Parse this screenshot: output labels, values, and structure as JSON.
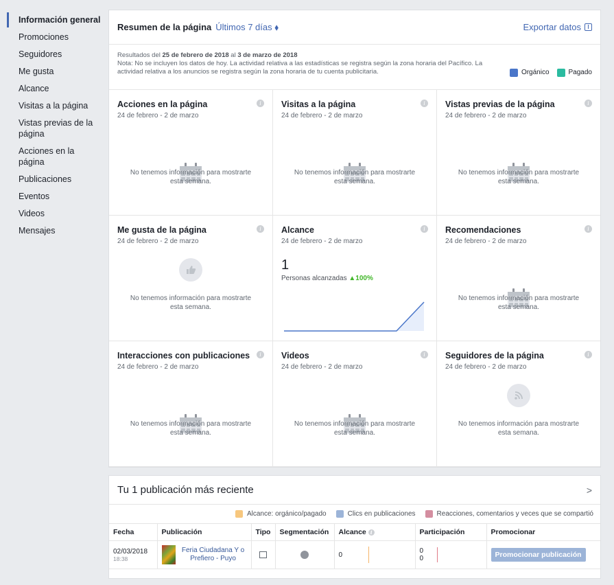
{
  "sidebar": {
    "items": [
      {
        "label": "Información general",
        "active": true
      },
      {
        "label": "Promociones"
      },
      {
        "label": "Seguidores"
      },
      {
        "label": "Me gusta"
      },
      {
        "label": "Alcance"
      },
      {
        "label": "Visitas a la página"
      },
      {
        "label": "Vistas previas de la página"
      },
      {
        "label": "Acciones en la página"
      },
      {
        "label": "Publicaciones"
      },
      {
        "label": "Eventos"
      },
      {
        "label": "Videos"
      },
      {
        "label": "Mensajes"
      }
    ]
  },
  "summary": {
    "title": "Resumen de la página",
    "range": "Últimos 7 días ⬧",
    "export_label": "Exportar datos",
    "results_prefix": "Resultados del ",
    "results_from": "25 de febrero de 2018",
    "results_mid": " al ",
    "results_to": "3 de marzo de 2018",
    "note": "Nota: No se incluyen los datos de hoy. La actividad relativa a las estadísticas se registra según la zona horaria del Pacífico. La actividad relativa a los anuncios se registra según la zona horaria de tu cuenta publicitaria.",
    "legend_organic": "Orgánico",
    "legend_paid": "Pagado",
    "color_organic": "#4a76c9",
    "color_paid": "#2bbba0"
  },
  "tiles": [
    {
      "title": "Acciones en la página",
      "date": "24 de febrero - 2 de marzo",
      "empty": "No tenemos información para mostrarte esta semana.",
      "icon": "calendar-icon"
    },
    {
      "title": "Visitas a la página",
      "date": "24 de febrero - 2 de marzo",
      "empty": "No tenemos información para mostrarte esta semana.",
      "icon": "calendar-icon"
    },
    {
      "title": "Vistas previas de la página",
      "date": "24 de febrero - 2 de marzo",
      "empty": "No tenemos información para mostrarte esta semana.",
      "icon": "calendar-icon"
    },
    {
      "title": "Me gusta de la página",
      "date": "24 de febrero - 2 de marzo",
      "empty": "No tenemos información para mostrarte esta semana.",
      "icon": "thumbs-up-icon"
    },
    {
      "title": "Alcance",
      "date": "24 de febrero - 2 de marzo",
      "value": "1",
      "value_label": "Personas alcanzadas",
      "change": "▲100%"
    },
    {
      "title": "Recomendaciones",
      "date": "24 de febrero - 2 de marzo",
      "empty": "No tenemos información para mostrarte esta semana.",
      "icon": "calendar-icon"
    },
    {
      "title": "Interacciones con publicaciones",
      "date": "24 de febrero - 2 de marzo",
      "empty": "No tenemos información para mostrarte esta semana.",
      "icon": "calendar-icon"
    },
    {
      "title": "Videos",
      "date": "24 de febrero - 2 de marzo",
      "empty": "No tenemos información para mostrarte esta semana.",
      "icon": "calendar-icon"
    },
    {
      "title": "Seguidores de la página",
      "date": "24 de febrero - 2 de marzo",
      "empty": "No tenemos información para mostrarte esta semana.",
      "icon": "rss-icon"
    }
  ],
  "recent": {
    "title": "Tu 1 publicación más reciente",
    "legend": [
      {
        "label": "Alcance: orgánico/pagado",
        "color": "#f7c77e"
      },
      {
        "label": "Clics en publicaciones",
        "color": "#9cb4d8"
      },
      {
        "label": "Reacciones, comentarios y veces que se compartió",
        "color": "#d48ea0"
      }
    ],
    "columns": [
      "Fecha",
      "Publicación",
      "Tipo",
      "Segmentación",
      "Alcance",
      "Participación",
      "Promocionar"
    ],
    "rows": [
      {
        "date": "02/03/2018",
        "time": "18:38",
        "publication": "Feria Ciudadana Y o Prefiero - Puyo",
        "reach": "0",
        "engagement_1": "0",
        "engagement_2": "0",
        "promote": "Promocionar publicación"
      }
    ]
  }
}
